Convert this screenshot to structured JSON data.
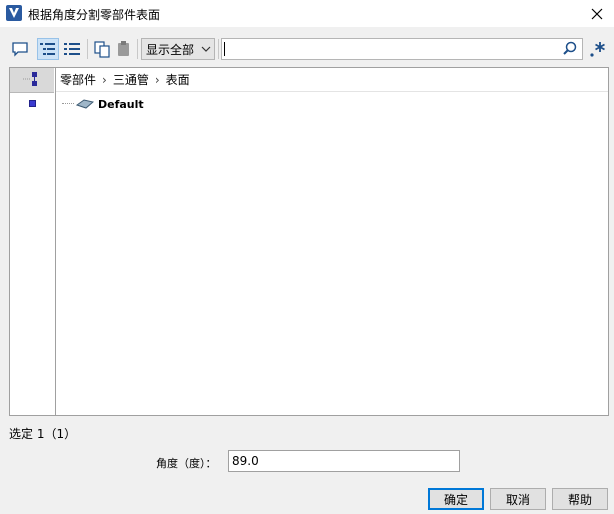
{
  "window": {
    "title": "根据角度分割零部件表面"
  },
  "toolbar": {
    "filter_value": "显示全部",
    "search_value": ""
  },
  "tree": {
    "breadcrumb": [
      "零部件",
      "三通管",
      "表面"
    ],
    "items": [
      {
        "label": "Default"
      }
    ]
  },
  "status": {
    "text": "选定 1（1）"
  },
  "angle": {
    "label": "角度（度）：",
    "value": "89.0"
  },
  "buttons": {
    "ok": "确定",
    "cancel": "取消",
    "help": "帮助"
  },
  "colors": {
    "accent": "#0078d7",
    "active_toggle": "#cde3f7",
    "marker": "#3a3ad0"
  }
}
